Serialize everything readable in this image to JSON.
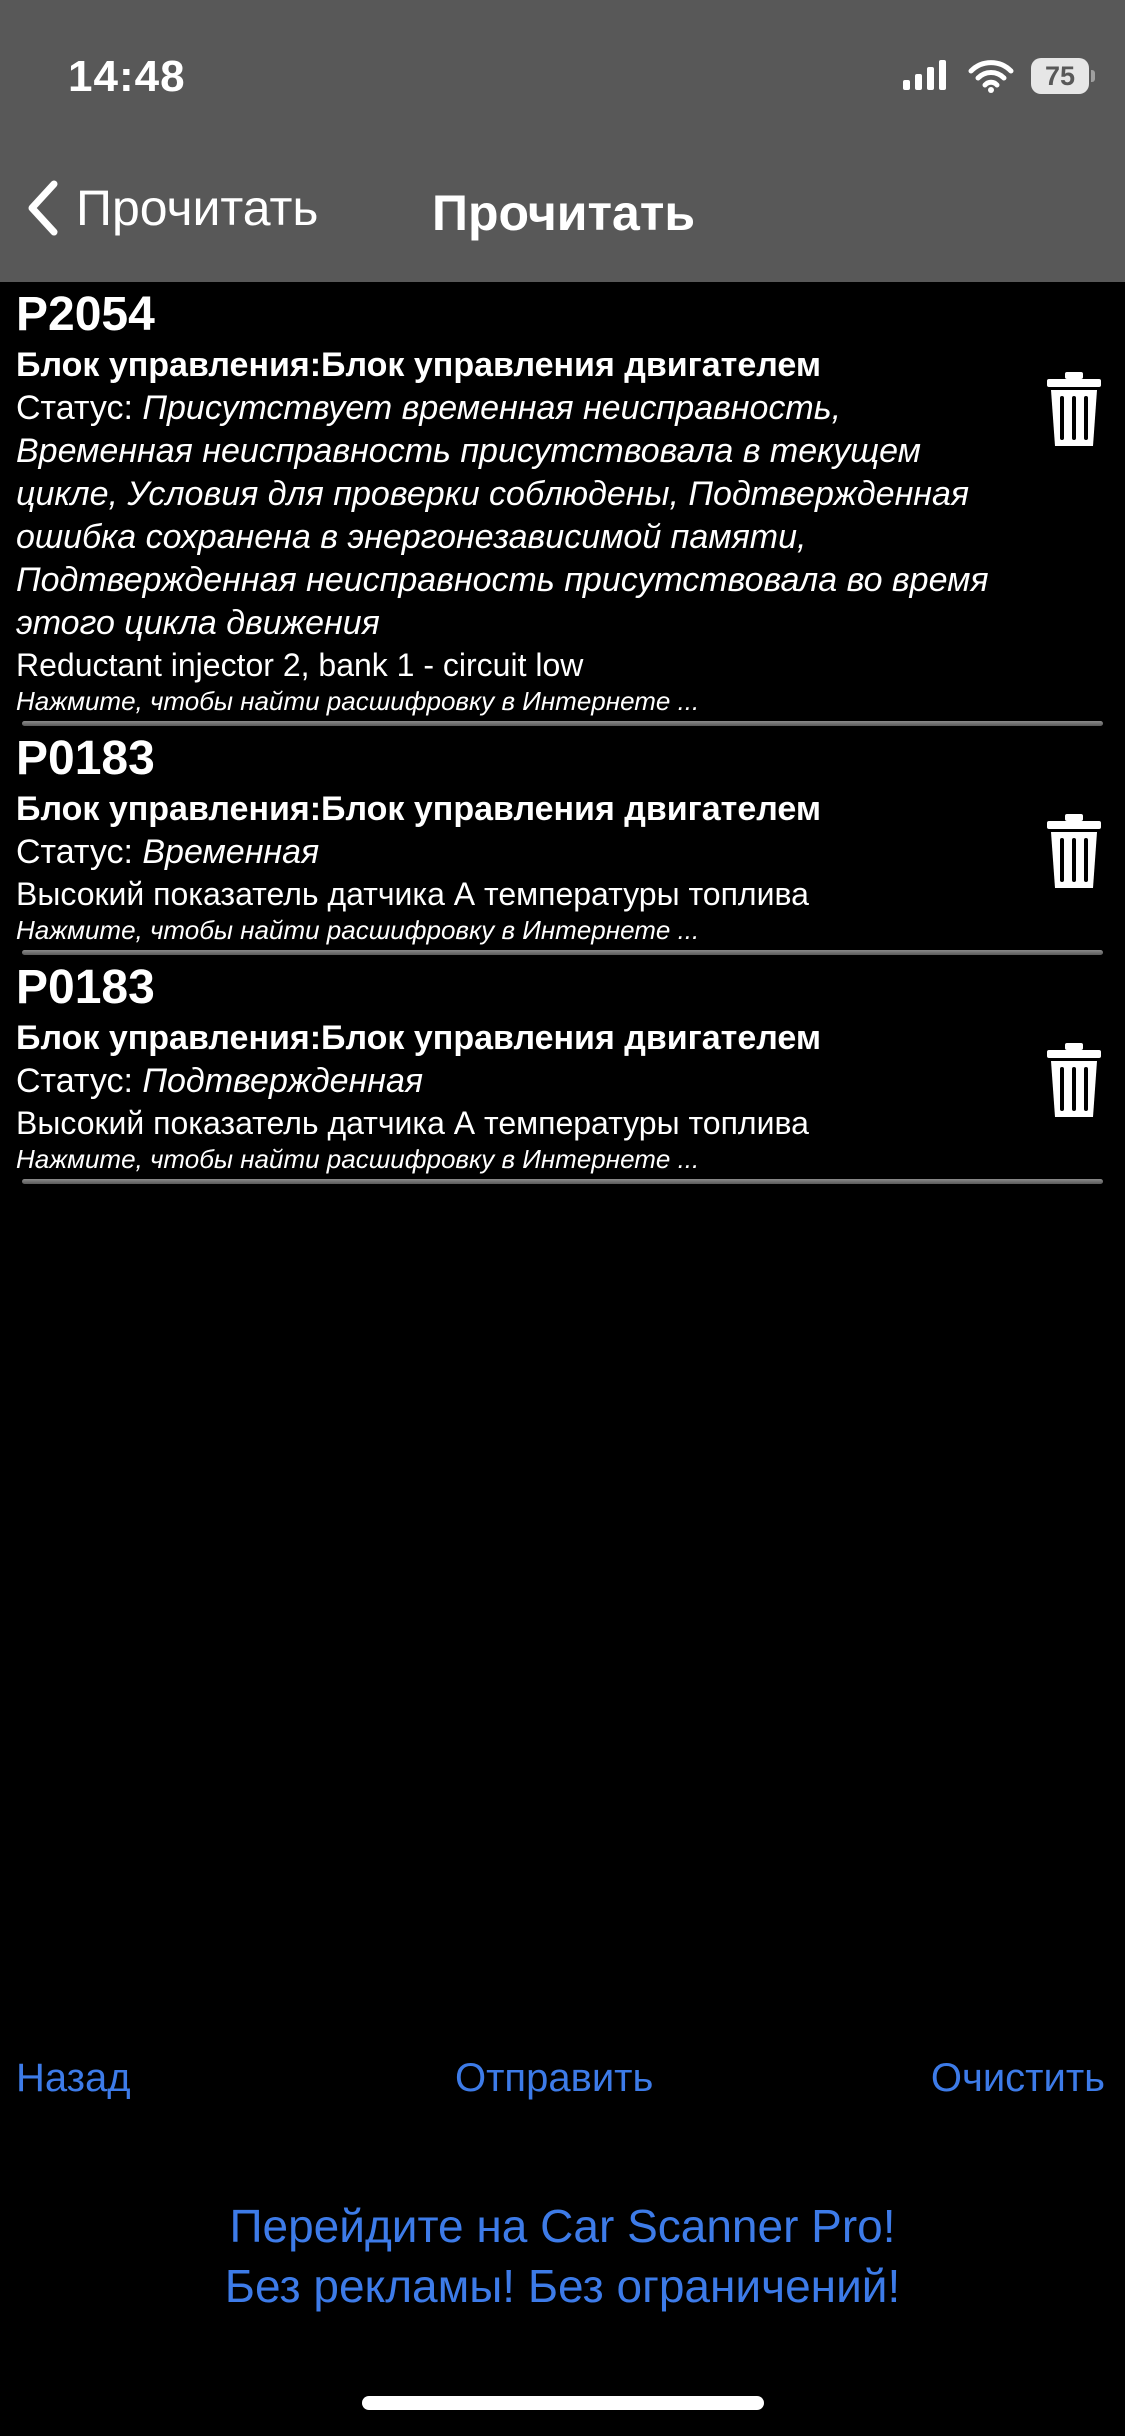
{
  "status_bar": {
    "time": "14:48",
    "battery": "75",
    "icons": [
      "signal-icon",
      "wifi-icon",
      "battery-icon"
    ]
  },
  "nav": {
    "back_label": "Прочитать",
    "title": "Прочитать"
  },
  "dtc_items": [
    {
      "code": "P2054",
      "module": "Блок управления:Блок управления двигателем",
      "status_label": "Статус: ",
      "status_value": "Присутствует временная неисправность, Временная неисправность присутствовала в текущем цикле, Условия для проверки соблюдены, Подтвержденная ошибка сохранена в энергонезависимой памяти, Подтвержденная неисправность присутствовала во время этого цикла движения",
      "description": "Reductant injector 2, bank 1 - circuit low",
      "hint": "Нажмите, чтобы найти расшифровку в Интернете ..."
    },
    {
      "code": "P0183",
      "module": "Блок управления:Блок управления двигателем",
      "status_label": "Статус: ",
      "status_value": "Временная",
      "description": "Высокий показатель датчика А температуры топлива",
      "hint": "Нажмите, чтобы найти расшифровку в Интернете ..."
    },
    {
      "code": "P0183",
      "module": "Блок управления:Блок управления двигателем",
      "status_label": "Статус: ",
      "status_value": "Подтвержденная",
      "description": "Высокий показатель датчика А температуры топлива",
      "hint": "Нажмите, чтобы найти расшифровку в Интернете ..."
    }
  ],
  "toolbar": {
    "back_label": "Назад",
    "send_label": "Отправить",
    "clear_label": "Очистить"
  },
  "promo": {
    "line1": "Перейдите на Car Scanner Pro!",
    "line2": "Без рекламы! Без ограничений!"
  },
  "colors": {
    "accent": "#3d7be8",
    "topbar": "#585858",
    "background": "#000000"
  }
}
